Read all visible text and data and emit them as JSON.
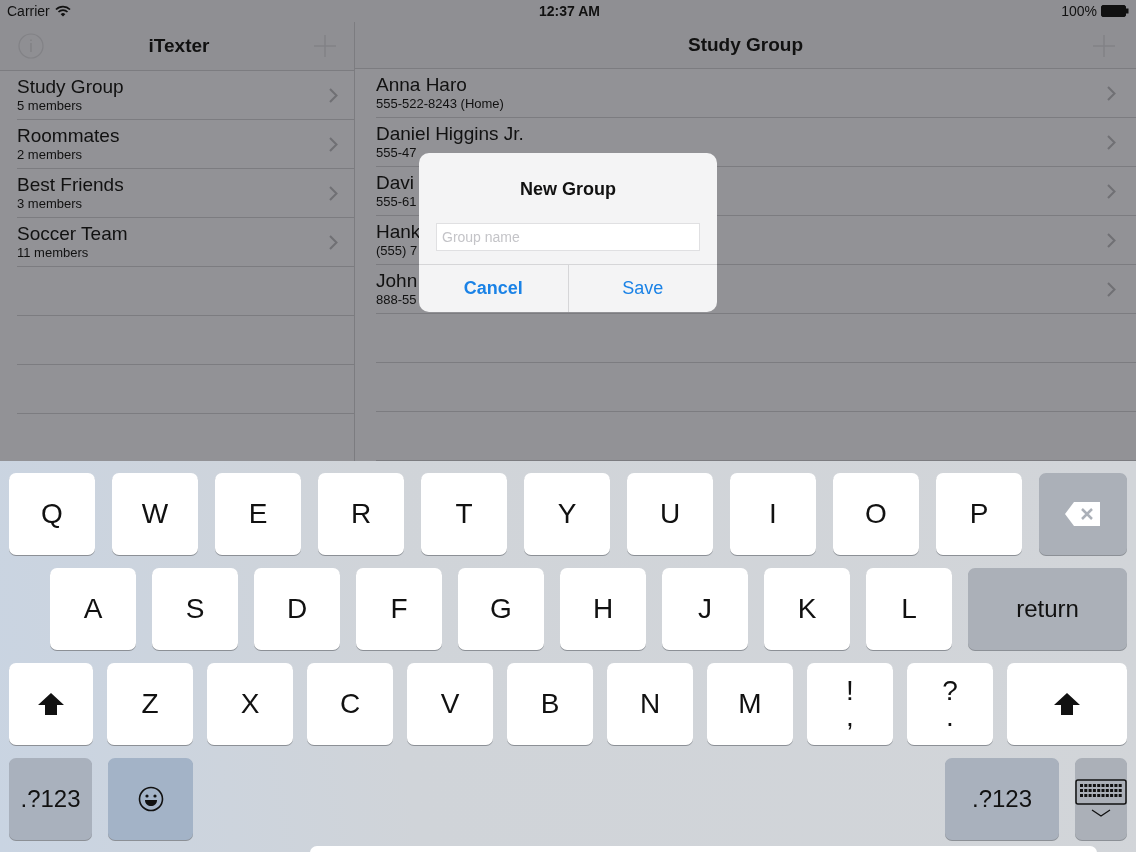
{
  "status_bar": {
    "carrier": "Carrier",
    "time": "12:37 AM",
    "battery": "100%"
  },
  "sidebar": {
    "title": "iTexter",
    "groups": [
      {
        "name": "Study Group",
        "subtitle": "5 members"
      },
      {
        "name": "Roommates",
        "subtitle": "2 members"
      },
      {
        "name": "Best Friends",
        "subtitle": "3 members"
      },
      {
        "name": "Soccer Team",
        "subtitle": "11 members"
      }
    ]
  },
  "detail": {
    "title": "Study Group",
    "contacts": [
      {
        "name": "Anna Haro",
        "phone": "555-522-8243 (Home)"
      },
      {
        "name": "Daniel Higgins Jr.",
        "phone": "555-47"
      },
      {
        "name": "Davi",
        "phone": "555-61"
      },
      {
        "name": "Hank",
        "phone": "(555) 7"
      },
      {
        "name": "John",
        "phone": "888-55"
      }
    ]
  },
  "dialog": {
    "title": "New Group",
    "placeholder": "Group name",
    "buttons": [
      {
        "label": "Cancel",
        "kind": "cancel"
      },
      {
        "label": "Save",
        "kind": "default"
      }
    ]
  },
  "keyboard": {
    "rows": [
      [
        {
          "label": "Q",
          "kind": "letter"
        },
        {
          "label": "W",
          "kind": "letter"
        },
        {
          "label": "E",
          "kind": "letter"
        },
        {
          "label": "R",
          "kind": "letter"
        },
        {
          "label": "T",
          "kind": "letter"
        },
        {
          "label": "Y",
          "kind": "letter"
        },
        {
          "label": "U",
          "kind": "letter"
        },
        {
          "label": "I",
          "kind": "letter"
        },
        {
          "label": "O",
          "kind": "letter"
        },
        {
          "label": "P",
          "kind": "letter"
        },
        {
          "kind": "delete"
        }
      ],
      [
        {
          "label": "A",
          "kind": "letter"
        },
        {
          "label": "S",
          "kind": "letter"
        },
        {
          "label": "D",
          "kind": "letter"
        },
        {
          "label": "F",
          "kind": "letter"
        },
        {
          "label": "G",
          "kind": "letter"
        },
        {
          "label": "H",
          "kind": "letter"
        },
        {
          "label": "J",
          "kind": "letter"
        },
        {
          "label": "K",
          "kind": "letter"
        },
        {
          "label": "L",
          "kind": "letter"
        },
        {
          "label": "return",
          "kind": "return"
        }
      ],
      [
        {
          "kind": "shift"
        },
        {
          "label": "Z",
          "kind": "letter"
        },
        {
          "label": "X",
          "kind": "letter"
        },
        {
          "label": "C",
          "kind": "letter"
        },
        {
          "label": "V",
          "kind": "letter"
        },
        {
          "label": "B",
          "kind": "letter"
        },
        {
          "label": "N",
          "kind": "letter"
        },
        {
          "label": "M",
          "kind": "letter"
        },
        {
          "label": "!",
          "secondary": ",",
          "kind": "letter"
        },
        {
          "label": "?",
          "secondary": ".",
          "kind": "letter"
        },
        {
          "kind": "shift"
        }
      ],
      [
        {
          "label": ".?123",
          "kind": "numbers"
        },
        {
          "kind": "emoji"
        },
        {
          "kind": "gap"
        },
        {
          "label": ".?123",
          "kind": "numbers"
        },
        {
          "kind": "hide"
        }
      ]
    ]
  }
}
